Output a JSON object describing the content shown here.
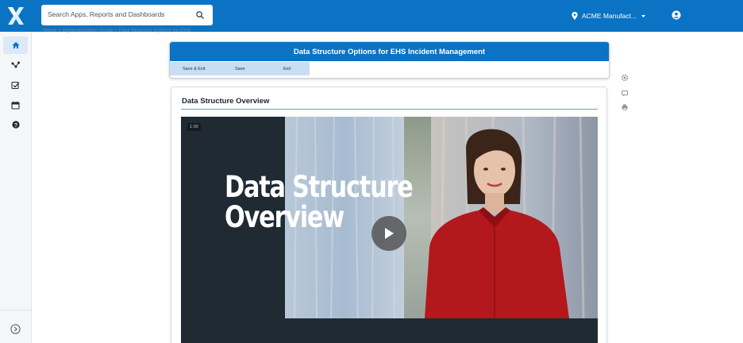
{
  "header": {
    "search_placeholder": "Search Apps, Reports and Dashboards",
    "org_name": "ACME Manufact...",
    "brand_color": "#0a73c4"
  },
  "breadcrumb": "Home > Implementation Guide > Data Structure Options for EHS",
  "sidebar": {
    "items": [
      {
        "icon": "home-icon",
        "active": true
      },
      {
        "icon": "workflow-icon",
        "active": false
      },
      {
        "icon": "tasks-icon",
        "active": false
      },
      {
        "icon": "calendar-icon",
        "active": false
      },
      {
        "icon": "help-icon",
        "active": false
      }
    ],
    "expand_icon": "chevron-right-icon"
  },
  "form": {
    "title": "Data Structure Options for EHS Incident Management",
    "actions": [
      "Save & Exit",
      "Save",
      "Exit"
    ]
  },
  "tools": [
    "settings-icon",
    "comment-icon",
    "print-icon"
  ],
  "section": {
    "title": "Data Structure Overview"
  },
  "video": {
    "timestamp": "1:00",
    "title": "Data Structure\nOverview"
  }
}
